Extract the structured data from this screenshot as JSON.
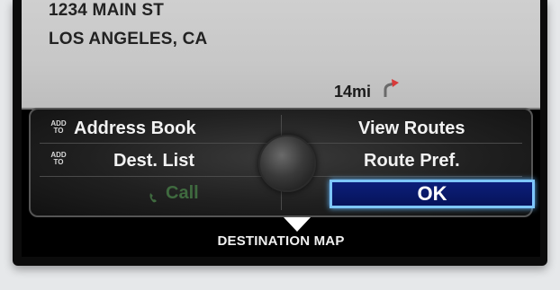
{
  "address": {
    "line1": "1234 MAIN ST",
    "line2": "LOS ANGELES, CA"
  },
  "distance": "14mi",
  "menu": {
    "address_book": {
      "label": "Address Book",
      "addto": [
        "ADD",
        "TO"
      ]
    },
    "dest_list": {
      "label": "Dest. List",
      "addto": [
        "ADD",
        "TO"
      ]
    },
    "call": {
      "label": "Call"
    },
    "view_routes": {
      "label": "View Routes"
    },
    "route_pref": {
      "label": "Route Pref."
    },
    "ok": {
      "label": "OK"
    }
  },
  "footer": {
    "label": "DESTINATION MAP"
  },
  "icons": {
    "distance": "route-arrow-icon",
    "call": "phone-icon",
    "scroll": "down-arrow-icon",
    "knob": "interface-knob-icon"
  },
  "colors": {
    "ok_border": "#7ec7ff",
    "ok_fill": "#0c1f7a",
    "call_disabled": "#3f6a3f"
  }
}
